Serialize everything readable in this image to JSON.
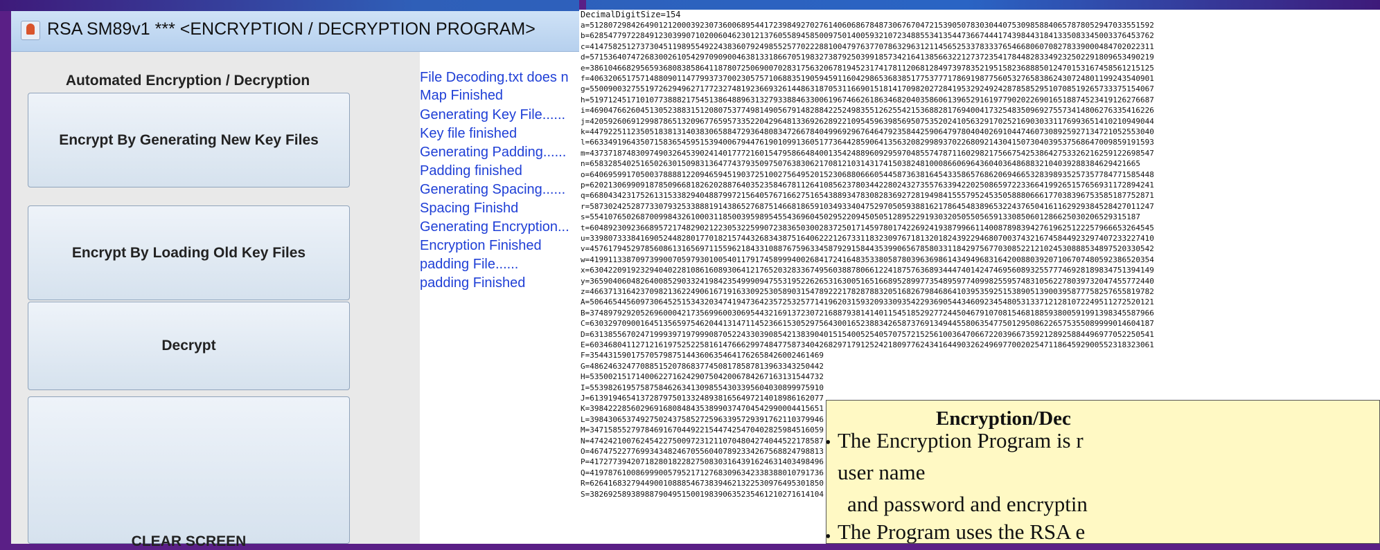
{
  "window": {
    "app_icon": "java-cup-icon",
    "title": "RSA SM89v1    ***  <ENCRYPTION / DECRYPTION PROGRAM>"
  },
  "left_panel": {
    "heading": "Automated Encryption / Decryption",
    "buttons": [
      "Encrypt By Generating New Key Files",
      "Encrypt By Loading Old Key Files",
      "Decrypt",
      "CLEAR SCREEN"
    ]
  },
  "log": [
    "File Decoding.txt does n",
    "Map Finished",
    "Generating Key File......",
    "Key file finished",
    "Generating Padding......",
    "Padding finished",
    "Generating Spacing......",
    "Spacing Finishd",
    "Generating Encryption...",
    "Encryption Finished",
    "padding File......",
    "padding Finished"
  ],
  "dump": {
    "header": "DecimalDigitSize=154",
    "lines": [
      "a=512807298426490121200039230736006895441723984927027614060686784873067670472153905078303044075309858840657878052947033551592",
      "b=628547797228491230399071020060462301213760558945850097501400593210723488553413544736674441743984431841335083345003376453762",
      "c=414758251273730451198955492243836079249855257702228810047976377078632963121145652533783337654668060708278339000484702022311",
      "d=571536407472683002610542970909004638133186670519832738792503991857342164138566322127372354178448283349232502291809653490219",
      "e=386104668295659368083858641187807250690070283175632067819452317417811206812849739783521951582368885012470153167458561215125",
      "f=406320651757148809011477993737002305757106883519059459116042986536838517753777178691987756053276583862430724801199243540901",
      "g=550090032755197262949627177232748192366932614486318705311669015181417098202728419532924924287858529510708519265733375154067",
      "h=519712451710107738882175451386488963132793388463300619674662618634682040358606139652916197790202269016518874523419126276687",
      "i=469047662604513052388315120807537749814905679148288422524983551262554215368828176940041732548350969275573414806276335416226",
      "j=420592606912998786513209677659573352204296481336926289221095459639856950753520241056329170252169030331176993651410210949044",
      "k=447922511235051838131403830658847293648083472667840499692967646479235844259064797804040269104474607308925927134721052553040",
      "l=663349196435071583654595153940067944761901099136051773644285906413563208299893702268092143041507304039537568647009859191593",
      "m=437371874830974903264539024140177721601547958664840013542488960929597048557478711602982175667542538642753326216259122698547",
      "n=658328540251650263015098313647743793509750763830621708121031431741503824810008660696436040364868832104039288384629421665",
      "o=640695991705003788881220946594519037251002756495201523068806660544587363816454335865768620694665328398935257357784771585448",
      "p=620213069909187850966818262028876403523584678112641085623780344228024327355763394220250865972233664199265157656931172894241",
      "q=668043423175261315338294048879972156405767166275165438893478308283692728194984155579524535058880666177038396753585187752871",
      "r=587302425287733079325338881914386527687514668186591034933404752970505938816217864548389653224376504161162929384528427011247",
      "s=554107650268700998432610003118500395989545543696045029522094505051289522919303205055056591330850601286625030206529315187",
      "t=604892309236689572174829021223053225990723836503002837250171459780174226924193879966114008789839427619625122257966653264545",
      "u=339807333841690524482801770182157443268343875164062221267331183230976718132018243922946807003743216745844923297407233227410",
      "v=457617945297856086131656971155962184331088767596334587929158443539906567858033118429756770308522121024530888534897520330542",
      "w=419911338709739900705979301005401179174589994002684172416483533805878039636986143494968316420088039207106707480592386520354",
      "x=630422091923294040228108616089306412176520328336749560388780661224187576368934447401424746956089325577746928189834751394149",
      "y=365904060482640085290332419842354999094755319522626531630051651668952899773548959774099825595748310562278039732047455772440",
      "z=466371316423709821362249061671916330925305890315478922217828788320516826798468641039535925153890513900395877758257655819782",
      "A=506465445609730645251534320347419473642357253257714196203159320933093542293690544346092345480531337121281072249511272520121",
      "B=374897929205269600042173569960030695443216913723072168879381414011545185292772445046791070815468188593800591991398345587966",
      "C=630329709001645135659754620441314711452366153052975643001652388342658737691349445580635477501295086226575355089999014604187",
      "D=631385567024719993971979990870522433039085421383904015154005254057075721525610036470667220396673592128925884496977052250541",
      "E=603468041127121619752522581614766629974847758734042682971791252421809776243416449032624969770020254711864592900552318323061",
      "F=354431590175705798751443606354641762658426002461469",
      "G=486246324770885152078683774508178587813963343250442",
      "H=535002151714006227162429075042006784267163131544732",
      "I=553982619575875846263413098554303395604030899975910",
      "J=613919465413728797501332489381656497214018986162077",
      "K=398422285602969168084843538990374704542990004415651",
      "L=398430653749275024375852725963395729391762110379946",
      "M=347158552797846916704492215447425470402825984516059",
      "N=474242100762454227500972312110704804274044522178587",
      "O=467475227769934348246705560407892334267568824798813",
      "P=417277394207182801822827508303164391624631403498496",
      "Q=419787610086999005795217127683096342338388010791736",
      "R=626416832794490010888546738394621322530976495301850",
      "S=382692589389887904951500198390635235461210271614104"
    ]
  },
  "notes": {
    "title": "Encryption/Dec",
    "lines": [
      "The Encryption Program is r",
      "user name",
      "and password and encryptin",
      "The Program uses the RSA e"
    ]
  }
}
